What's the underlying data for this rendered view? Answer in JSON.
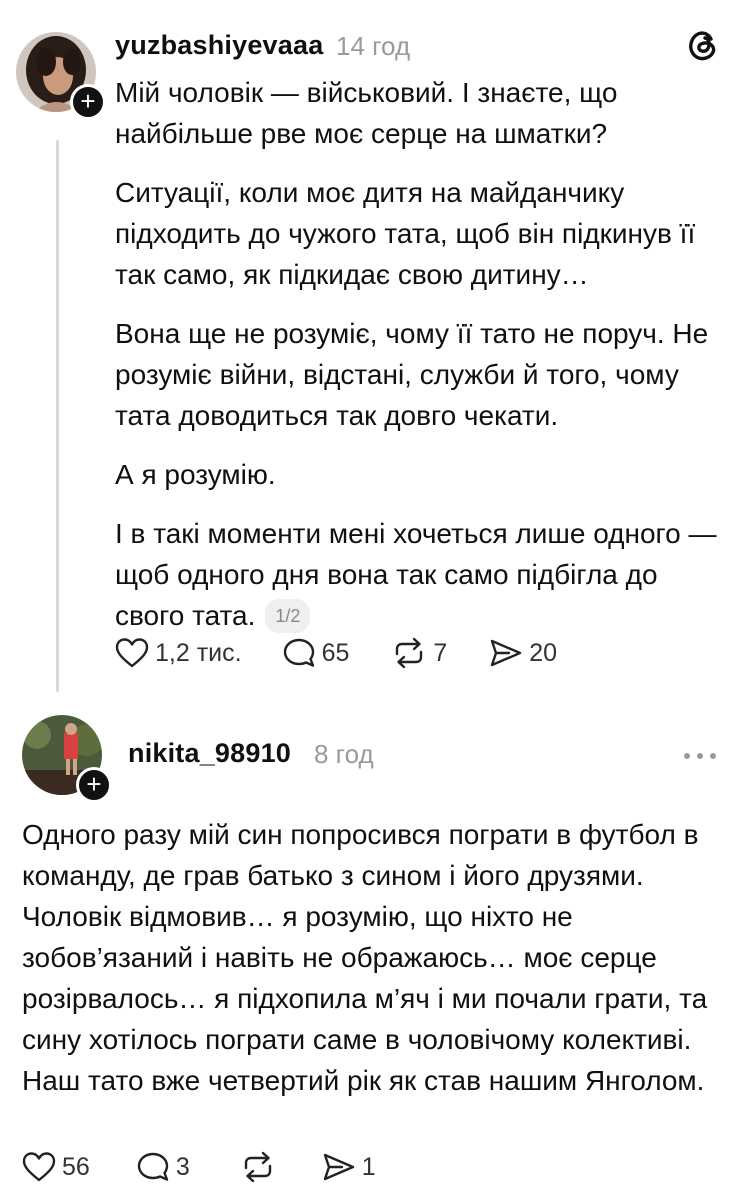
{
  "post1": {
    "username": "yuzbashiyevaaa",
    "time": "14 год",
    "paragraphs": [
      "Мій чоловік — військовий. І знаєте, що найбільше рве моє серце на шматки?",
      "Ситуації, коли моє дитя на майданчику підходить до чужого тата, щоб він підкинув її так само, як підкидає свою дитину…",
      "Вона ще не розуміє, чому її тато не поруч. Не розуміє війни, відстані, служби й того, чому тата доводиться так довго чекати.",
      "А я розумію.",
      "І в такі моменти мені хочеться лише одного — щоб одного дня вона так само підбігла до свого тата."
    ],
    "page_indicator": "1/2",
    "likes": "1,2 тис.",
    "comments": "65",
    "reposts": "7",
    "shares": "20"
  },
  "post2": {
    "username": "nikita_98910",
    "time": "8 год",
    "text": "Одного разу мій син попросився пограти в футбол в команду, де грав батько з сином і його друзями. Чоловік відмовив… я розумію, що ніхто не зобов’язаний і навіть не ображаюсь… моє серце розірвалось… я підхопила м’яч і ми почали грати, та сину хотілось пограти саме в чоловічому колективі. Наш тато вже четвертий рік як став нашим Янголом.",
    "likes": "56",
    "comments": "3",
    "reposts": "",
    "shares": "1"
  },
  "icons": {
    "app_logo": "threads-logo-icon",
    "follow": "plus-icon",
    "like": "heart-icon",
    "comment": "comment-bubble-icon",
    "repost": "repost-icon",
    "share": "send-icon",
    "more": "more-dots-icon"
  }
}
